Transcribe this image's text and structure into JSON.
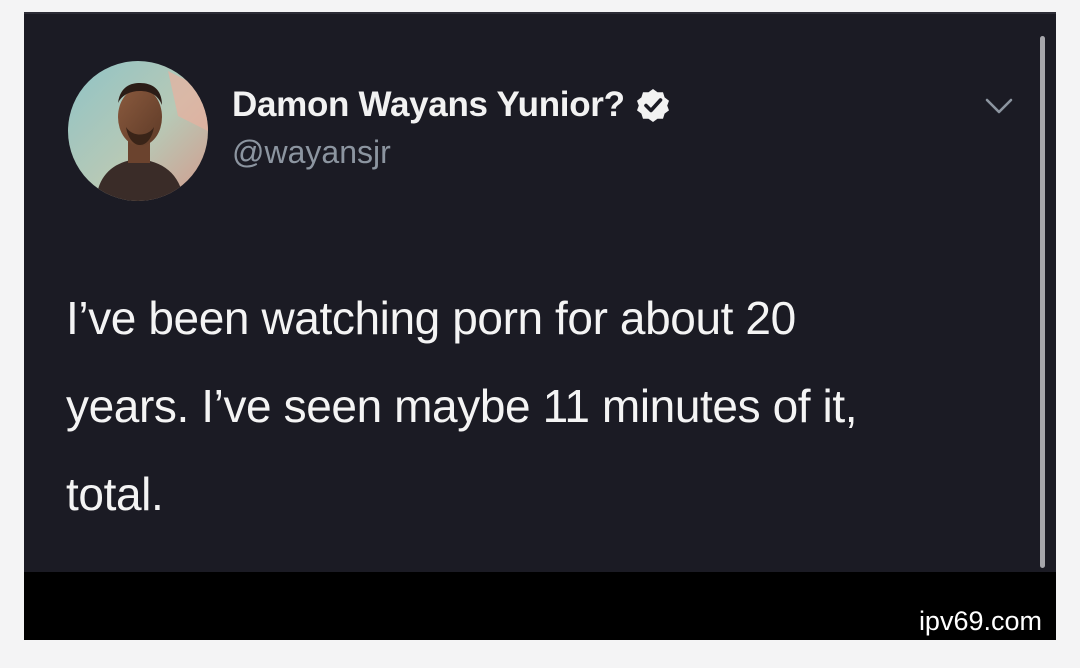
{
  "tweet": {
    "display_name": "Damon Wayans Yunior?",
    "handle": "@wayansjr",
    "verified": true,
    "text_lines": [
      "I’ve been watching porn for about 20",
      "years. I’ve seen maybe 11 minutes of it,",
      "total."
    ]
  },
  "icons": {
    "verified": "verified-badge-icon",
    "menu": "chevron-down-icon",
    "avatar": "profile-photo"
  },
  "watermark": "ipv69.com",
  "colors": {
    "card_background": "#1b1b24",
    "text_primary": "#f4f4f4",
    "text_secondary": "#8c95a0",
    "frame": "#000000",
    "page_background": "#f4f4f5"
  }
}
